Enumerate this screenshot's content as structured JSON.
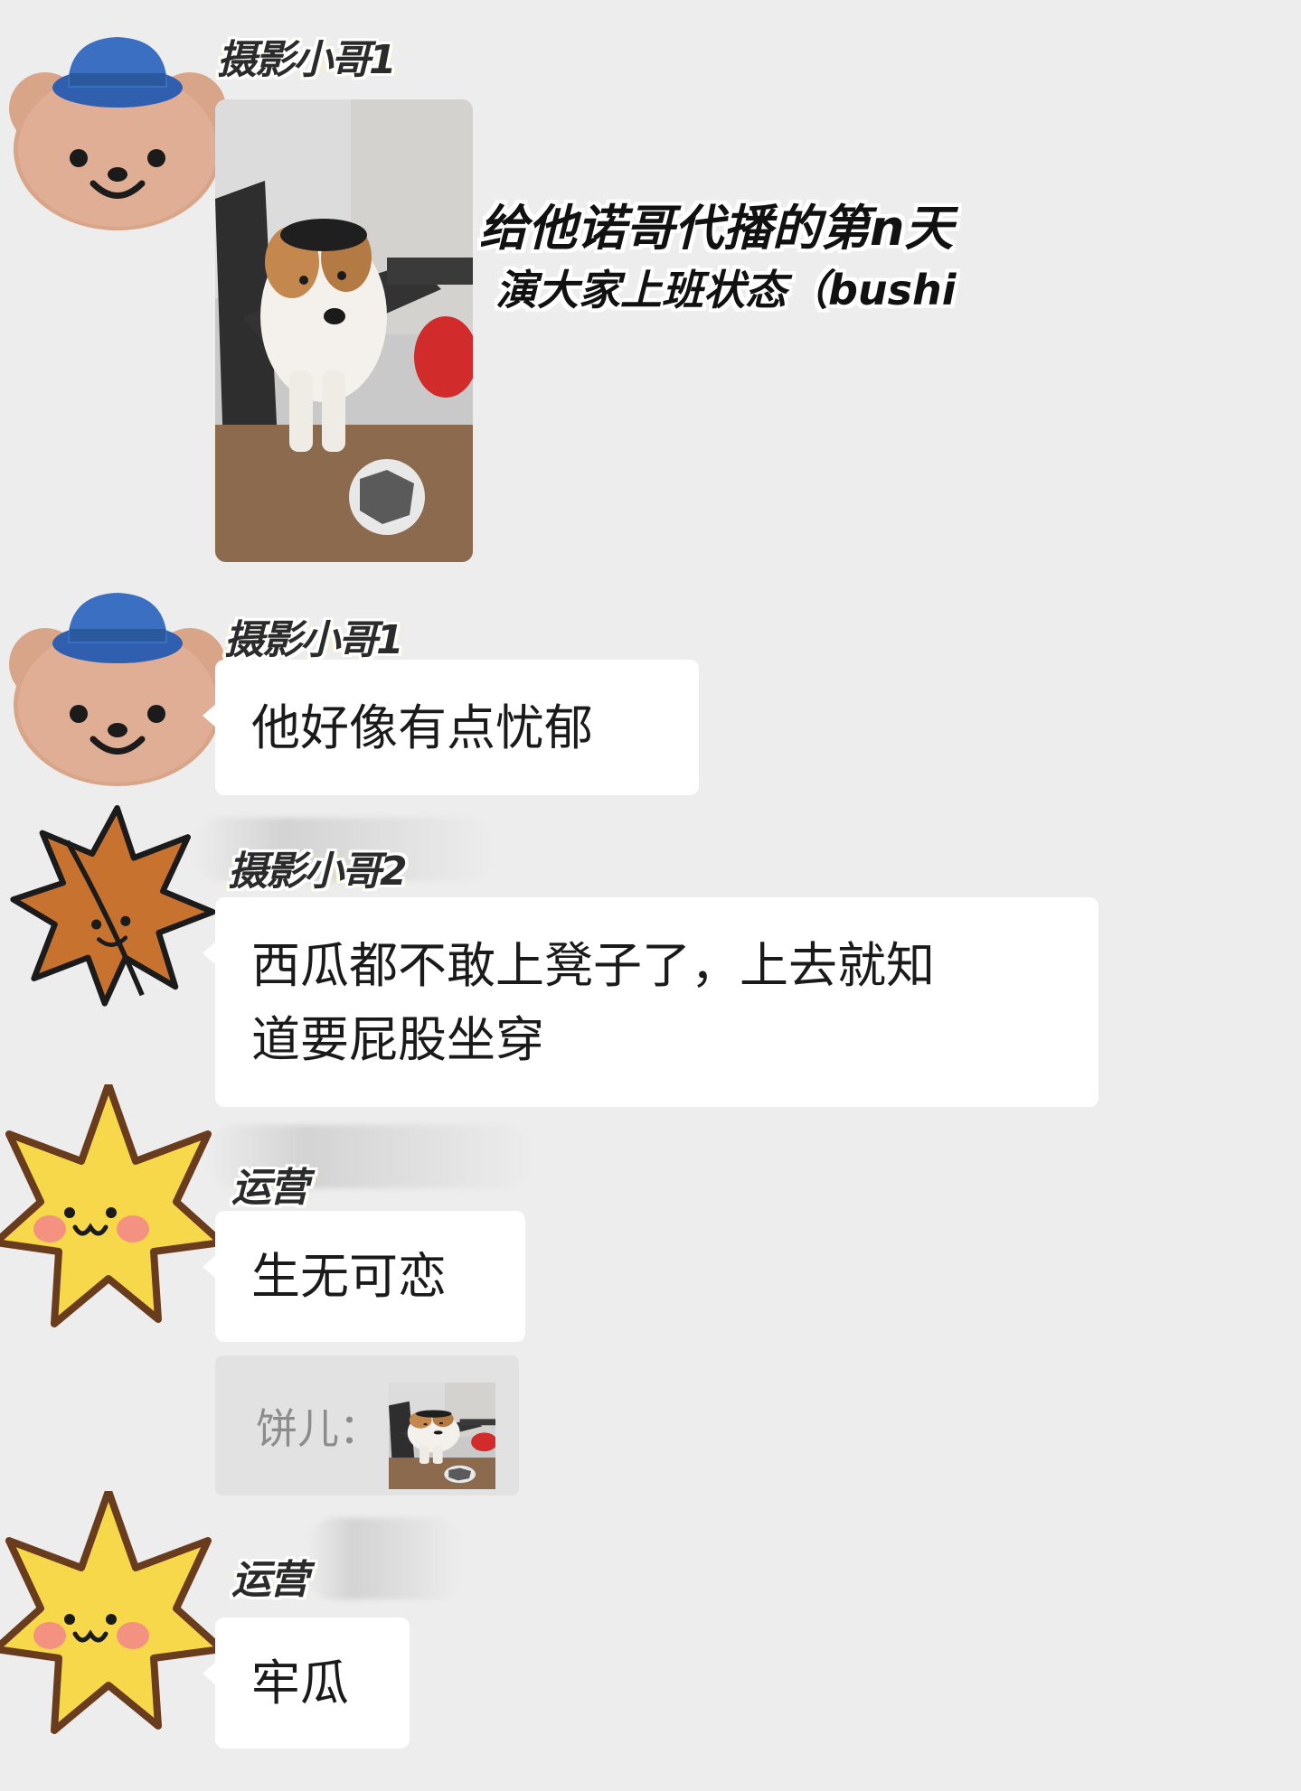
{
  "messages": [
    {
      "sender": "摄影小哥1",
      "type": "image",
      "avatar": "bear-with-blue-hat-icon",
      "overlay_caption": [
        "给他诺哥代播的第n天",
        "演大家上班状态（bushi"
      ]
    },
    {
      "sender": "摄影小哥1",
      "type": "text",
      "avatar": "bear-with-blue-hat-icon",
      "text": "他好像有点忧郁"
    },
    {
      "sender": "摄影小哥2",
      "type": "text",
      "avatar": "maple-leaf-icon",
      "text_lines": [
        "西瓜都不敢上凳子了，上去就知",
        "道要屁股坐穿"
      ]
    },
    {
      "sender": "运营",
      "type": "text",
      "avatar": "smiling-star-icon",
      "text": "生无可恋",
      "quote": {
        "label": "饼儿："
      }
    },
    {
      "sender": "运营",
      "type": "text",
      "avatar": "smiling-star-icon",
      "text": "牢瓜"
    }
  ],
  "colors": {
    "background": "#ededed",
    "bubble": "#ffffff",
    "quote_bg": "#e2e2e2"
  }
}
